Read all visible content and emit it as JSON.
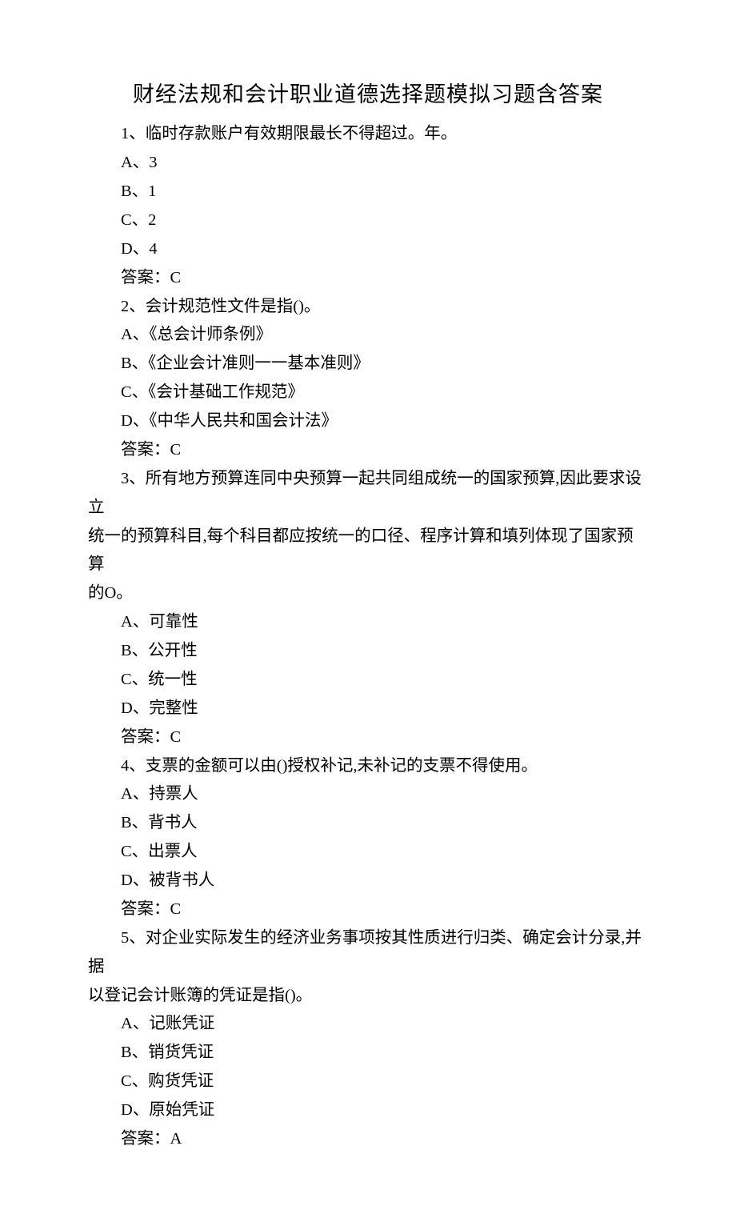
{
  "title": "财经法规和会计职业道德选择题模拟习题含答案",
  "q1": {
    "stem": "1、临时存款账户有效期限最长不得超过。年。",
    "a": "A、3",
    "b": "B、1",
    "c": "C、2",
    "d": "D、4",
    "ans": "答案：C"
  },
  "q2": {
    "stem": "2、会计规范性文件是指()。",
    "a": "A、《总会计师条例》",
    "b": "B、《企业会计准则一一基本准则》",
    "c": "C、《会计基础工作规范》",
    "d": "D、《中华人民共和国会计法》",
    "ans": "答案：C"
  },
  "q3": {
    "stem1": "3、所有地方预算连同中央预算一起共同组成统一的国家预算,因此要求设立",
    "stem2": "统一的预算科目,每个科目都应按统一的口径、程序计算和填列体现了国家预算",
    "stem3": "的O。",
    "a": "A、可靠性",
    "b": "B、公开性",
    "c": "C、统一性",
    "d": "D、完整性",
    "ans": "答案：C"
  },
  "q4": {
    "stem": "4、支票的金额可以由()授权补记,未补记的支票不得使用。",
    "a": "A、持票人",
    "b": "B、背书人",
    "c": "C、出票人",
    "d": "D、被背书人",
    "ans": "答案：C"
  },
  "q5": {
    "stem1": "5、对企业实际发生的经济业务事项按其性质进行归类、确定会计分录,并据",
    "stem2": "以登记会计账簿的凭证是指()。",
    "a": "A、记账凭证",
    "b": "B、销货凭证",
    "c": "C、购货凭证",
    "d": "D、原始凭证",
    "ans": "答案：A"
  }
}
